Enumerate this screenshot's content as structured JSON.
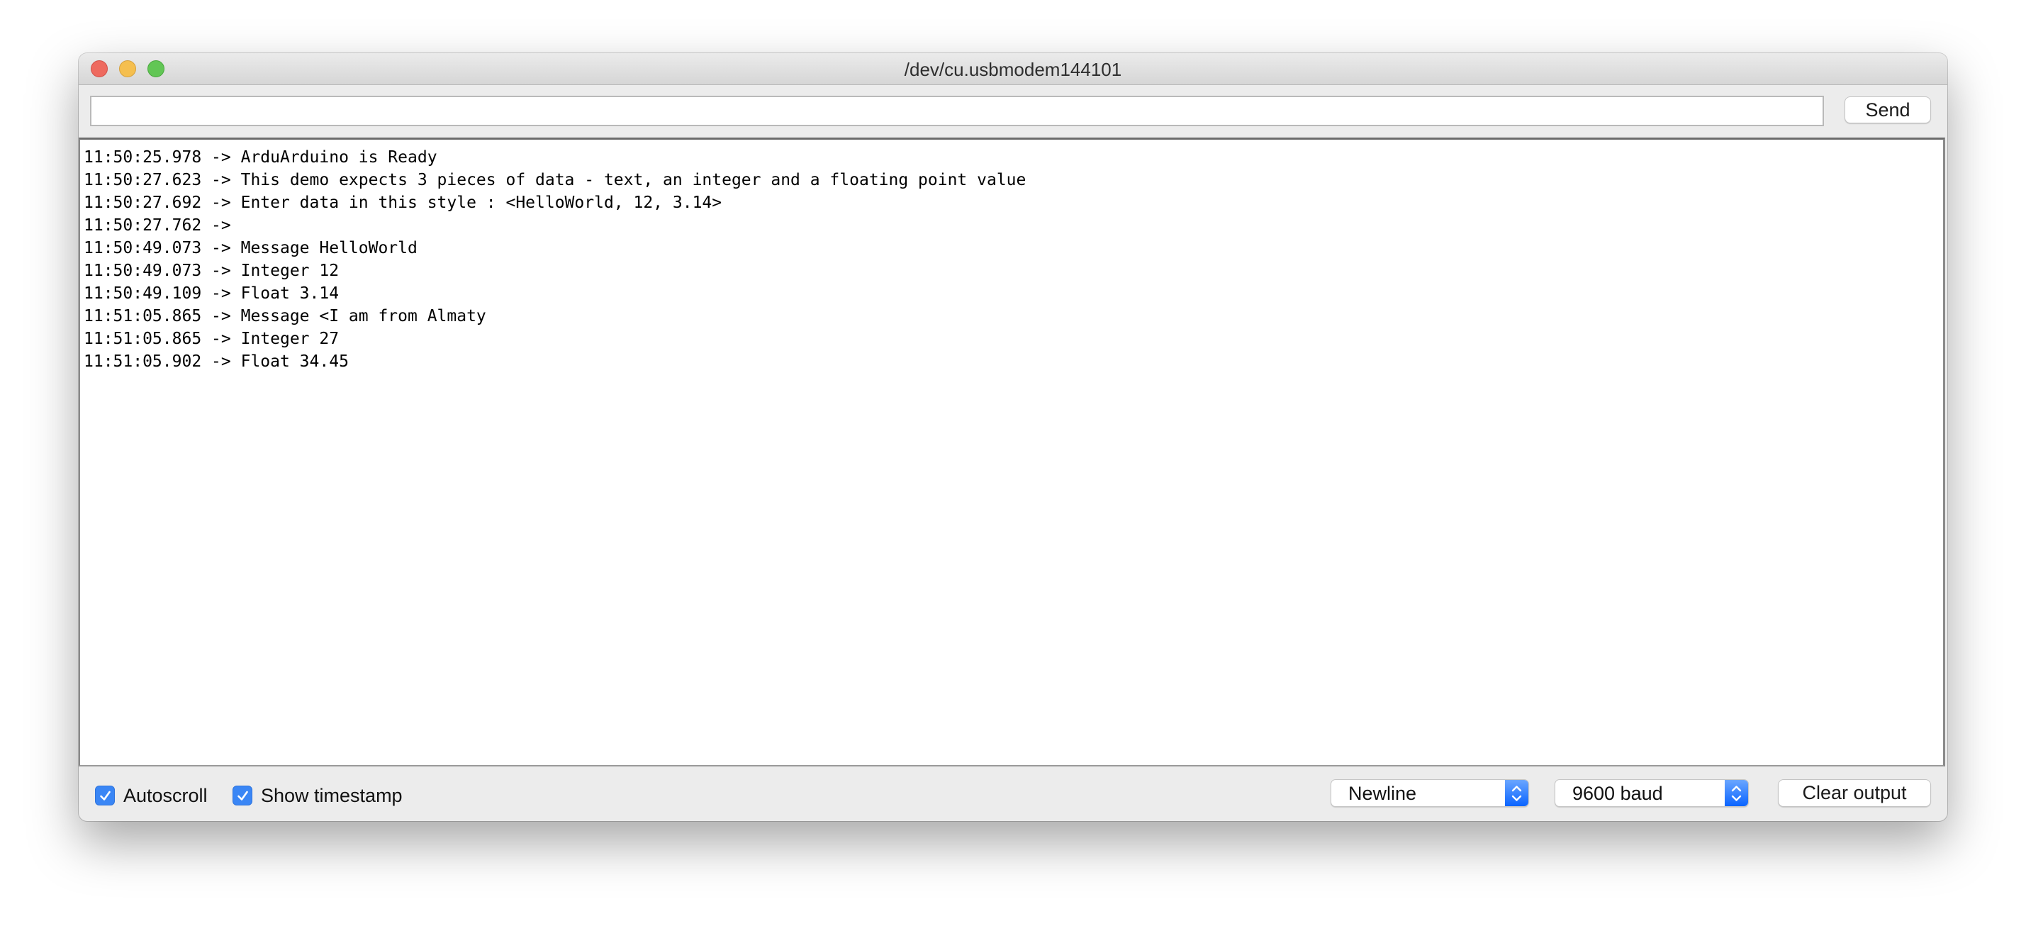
{
  "window": {
    "title": "/dev/cu.usbmodem144101",
    "controls": {
      "close_color": "#ee6a5f",
      "minimize_color": "#f5bf4f",
      "maximize_color": "#62c655"
    }
  },
  "input_bar": {
    "value": "",
    "placeholder": "",
    "send_label": "Send"
  },
  "output": {
    "lines": [
      {
        "timestamp": "11:50:25.978",
        "arrow": "->",
        "text": "ArduArduino is Ready"
      },
      {
        "timestamp": "11:50:27.623",
        "arrow": "->",
        "text": "This demo expects 3 pieces of data - text, an integer and a floating point value"
      },
      {
        "timestamp": "11:50:27.692",
        "arrow": "->",
        "text": "Enter data in this style : <HelloWorld, 12, 3.14>"
      },
      {
        "timestamp": "11:50:27.762",
        "arrow": "->",
        "text": ""
      },
      {
        "timestamp": "11:50:49.073",
        "arrow": "->",
        "text": "Message HelloWorld"
      },
      {
        "timestamp": "11:50:49.073",
        "arrow": "->",
        "text": "Integer 12"
      },
      {
        "timestamp": "11:50:49.109",
        "arrow": "->",
        "text": "Float 3.14"
      },
      {
        "timestamp": "11:51:05.865",
        "arrow": "->",
        "text": "Message <I am from Almaty"
      },
      {
        "timestamp": "11:51:05.865",
        "arrow": "->",
        "text": "Integer 27"
      },
      {
        "timestamp": "11:51:05.902",
        "arrow": "->",
        "text": "Float 34.45"
      }
    ]
  },
  "footer": {
    "autoscroll": {
      "label": "Autoscroll",
      "checked": true,
      "icon": "checkmark-icon"
    },
    "show_timestamp": {
      "label": "Show timestamp",
      "checked": true,
      "icon": "checkmark-icon"
    },
    "line_ending": {
      "selected": "Newline",
      "icon": "up-down-chevron-icon"
    },
    "baud_rate": {
      "selected": "9600 baud",
      "icon": "up-down-chevron-icon"
    },
    "clear_label": "Clear output",
    "accent_color": "#3a86f5"
  }
}
